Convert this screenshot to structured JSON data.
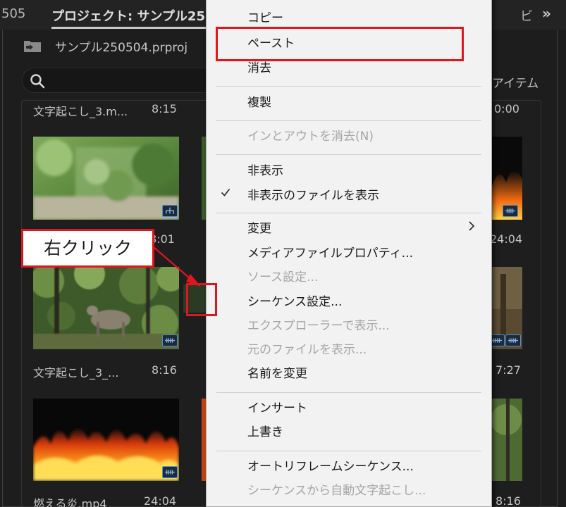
{
  "tabs": {
    "prev_fragment": "505",
    "active_label": "プロジェクト: サンプル25",
    "right_fragment": "ビ",
    "overflow_glyph": "»"
  },
  "project": {
    "file_name": "サンプル250504.prproj"
  },
  "search": {
    "placeholder": ""
  },
  "items_label": "アイテム",
  "clips": [
    {
      "name": "文字起こし_3.m...",
      "duration": "8:15"
    },
    {
      "name": "",
      "duration": "8:01"
    },
    {
      "name": "文字起こし_3_...",
      "duration": "8:16"
    },
    {
      "name": "燃える炎.mp4",
      "duration": "24:04"
    }
  ],
  "right_column_durations": [
    "0:00",
    "24:04",
    "7:27",
    "8:16"
  ],
  "context_menu": {
    "items": [
      {
        "label": "コピー",
        "enabled": true
      },
      {
        "label": "ペースト",
        "enabled": true,
        "highlighted": true
      },
      {
        "label": "消去",
        "enabled": true
      },
      {
        "label": "複製",
        "enabled": true
      },
      {
        "label": "インとアウトを消去(N)",
        "enabled": false
      },
      {
        "label": "非表示",
        "enabled": true
      },
      {
        "label": "非表示のファイルを表示",
        "enabled": true,
        "checked": true
      },
      {
        "label": "変更",
        "enabled": true,
        "submenu": true
      },
      {
        "label": "メディアファイルプロパティ...",
        "enabled": true
      },
      {
        "label": "ソース設定...",
        "enabled": false
      },
      {
        "label": "シーケンス設定...",
        "enabled": true
      },
      {
        "label": "エクスプローラーで表示...",
        "enabled": false
      },
      {
        "label": "元のファイルを表示...",
        "enabled": false
      },
      {
        "label": "名前を変更",
        "enabled": true
      },
      {
        "label": "インサート",
        "enabled": true
      },
      {
        "label": "上書き",
        "enabled": true
      },
      {
        "label": "オートリフレームシーケンス...",
        "enabled": true
      },
      {
        "label": "シーケンスから自動文字起こし...",
        "enabled": false
      }
    ]
  },
  "annotation": {
    "callout_text": "右クリック",
    "accent_color": "#e0161e"
  },
  "colors": {
    "panel_bg": "#1d1d1d",
    "badge_blue": "#4a8fd9",
    "menu_bg": "#f2f2f2"
  },
  "icons": {
    "search": "search-icon",
    "project_file": "project-file-icon",
    "check": "check-icon",
    "submenu": "chevron-right-icon",
    "overflow": "overflow-chevrons-icon"
  }
}
